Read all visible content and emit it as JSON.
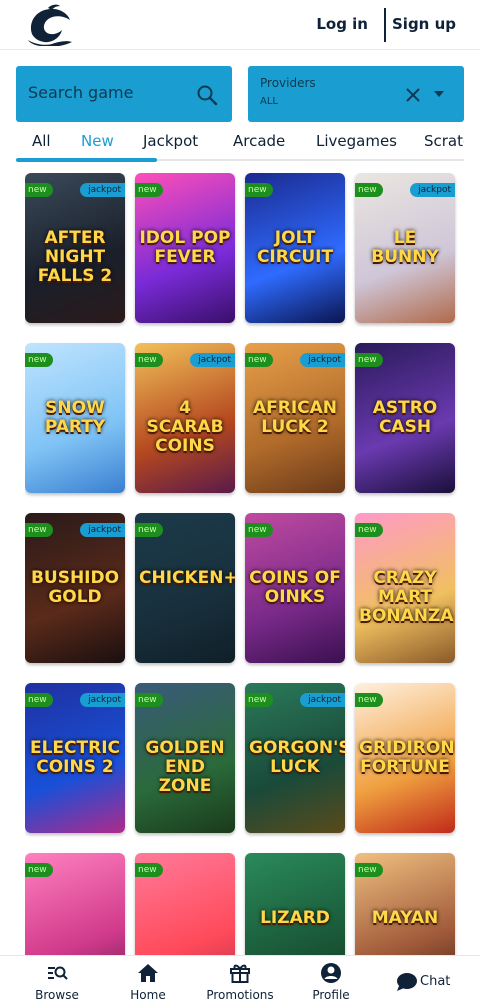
{
  "header": {
    "login_label": "Log in",
    "signup_label": "Sign up",
    "logo_icon": "dolphin-logo-icon"
  },
  "search": {
    "placeholder": "Search game"
  },
  "providers": {
    "label": "Providers",
    "value": "ALL"
  },
  "tabs": [
    {
      "label": "All",
      "active": false
    },
    {
      "label": "New",
      "active": true
    },
    {
      "label": "Jackpot",
      "active": false
    },
    {
      "label": "Arcade",
      "active": false
    },
    {
      "label": "Livegames",
      "active": false
    },
    {
      "label": "Scratc",
      "active": false
    }
  ],
  "badges": {
    "new": "new",
    "jackpot": "jackpot"
  },
  "games": [
    {
      "title": "AFTER NIGHT FALLS 2",
      "new": true,
      "jackpot": true
    },
    {
      "title": "IDOL POP FEVER",
      "new": true,
      "jackpot": false
    },
    {
      "title": "JOLT CIRCUIT",
      "new": true,
      "jackpot": false
    },
    {
      "title": "LE BUNNY",
      "new": true,
      "jackpot": true
    },
    {
      "title": "SNOW PARTY",
      "new": true,
      "jackpot": false
    },
    {
      "title": "4 SCARAB COINS",
      "new": true,
      "jackpot": true
    },
    {
      "title": "AFRICAN LUCK 2",
      "new": true,
      "jackpot": true
    },
    {
      "title": "ASTRO CASH",
      "new": true,
      "jackpot": false
    },
    {
      "title": "BUSHIDO GOLD",
      "new": true,
      "jackpot": true
    },
    {
      "title": "CHICKEN+",
      "new": true,
      "jackpot": false
    },
    {
      "title": "COINS OF OINKS",
      "new": true,
      "jackpot": false
    },
    {
      "title": "CRAZY MART BONANZA",
      "new": true,
      "jackpot": false
    },
    {
      "title": "ELECTRIC COINS 2",
      "new": true,
      "jackpot": true
    },
    {
      "title": "GOLDEN END ZONE",
      "new": true,
      "jackpot": false
    },
    {
      "title": "GORGON'S LUCK",
      "new": true,
      "jackpot": true
    },
    {
      "title": "GRIDIRON FORTUNE",
      "new": true,
      "jackpot": false
    },
    {
      "title": "",
      "new": true,
      "jackpot": false
    },
    {
      "title": "",
      "new": true,
      "jackpot": false
    },
    {
      "title": "LIZARD",
      "new": false,
      "jackpot": false
    },
    {
      "title": "MAYAN",
      "new": true,
      "jackpot": false
    }
  ],
  "bottom_nav": [
    {
      "label": "Browse",
      "icon": "browse-icon"
    },
    {
      "label": "Home",
      "icon": "home-icon"
    },
    {
      "label": "Promotions",
      "icon": "gift-icon"
    },
    {
      "label": "Profile",
      "icon": "profile-icon"
    }
  ],
  "chat": {
    "label": "Chat",
    "icon": "chat-bubble-icon"
  },
  "colors": {
    "accent": "#1a9ed1",
    "text": "#0f2237",
    "new_badge": "#1e8f1e"
  }
}
